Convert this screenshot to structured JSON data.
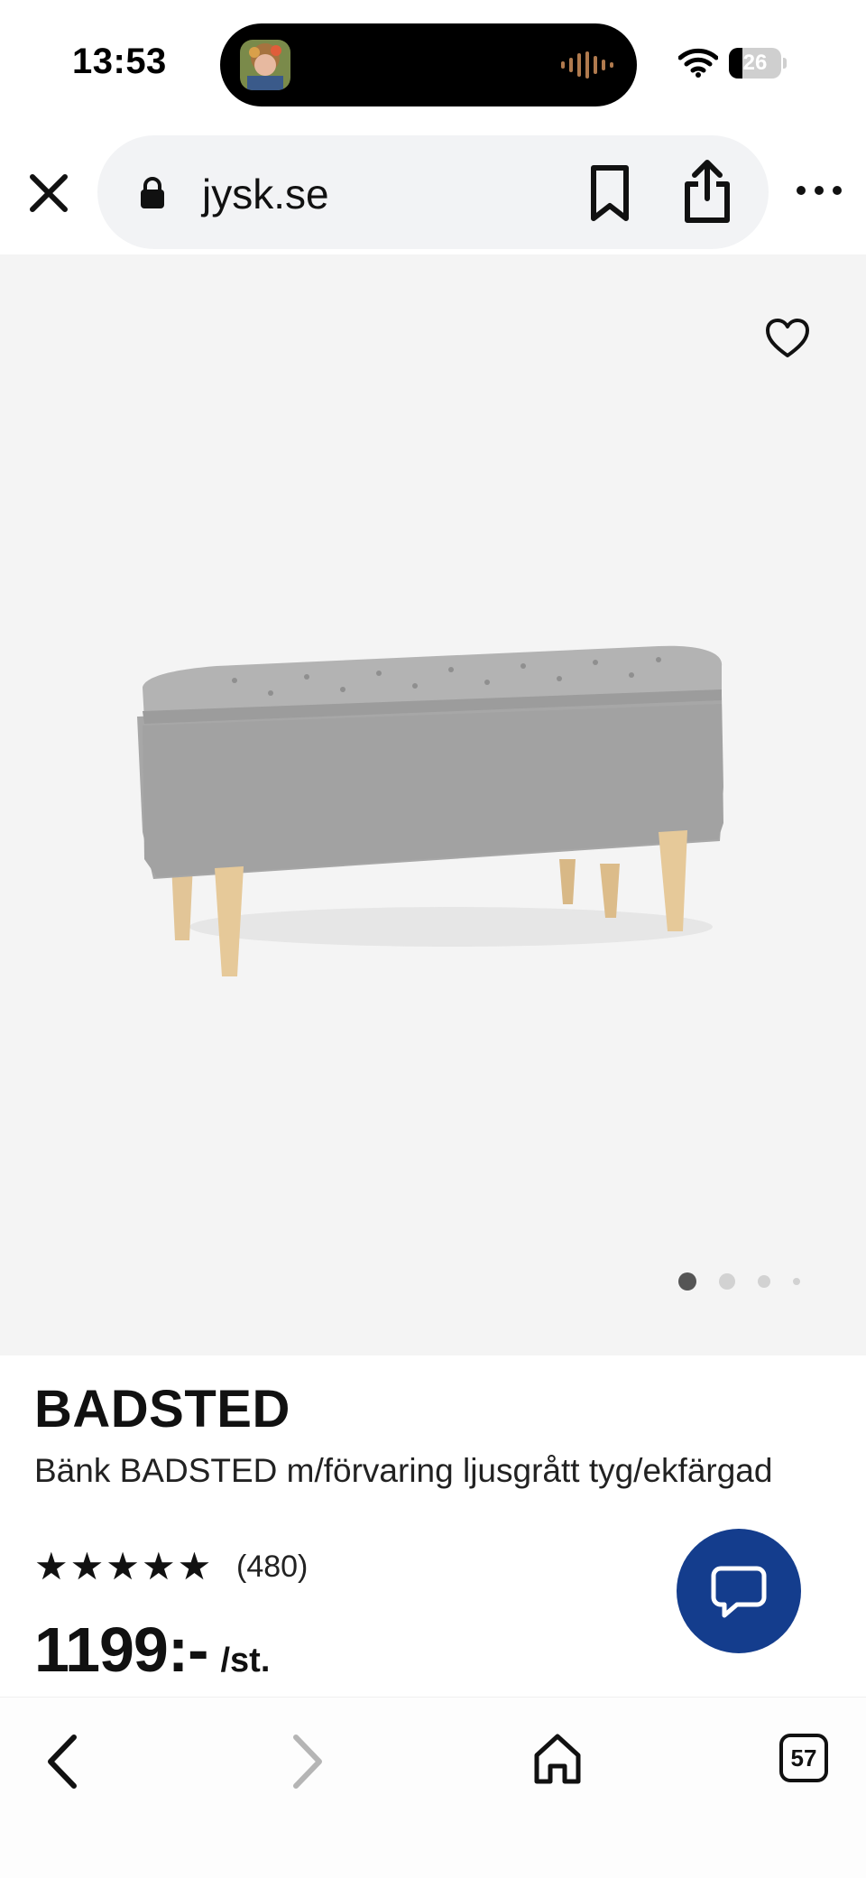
{
  "status_bar": {
    "time": "13:53",
    "battery_level": "26",
    "battery_fraction": 0.26
  },
  "browser": {
    "url": "jysk.se"
  },
  "product": {
    "name": "BADSTED",
    "description": "Bänk BADSTED m/förvaring ljusgrått tyg/ekfärgad",
    "rating_value": 5,
    "rating_max": 5,
    "review_count": "(480)",
    "price": "1199:-",
    "price_unit": "/st."
  },
  "carousel": {
    "total_images": 4,
    "active_index": 0
  },
  "tabs": {
    "count": "57"
  },
  "colors": {
    "chat_button": "#143d8d",
    "image_background": "#f4f4f4",
    "fabric": "#a5a5a5",
    "wood_legs": "#e2c597"
  }
}
